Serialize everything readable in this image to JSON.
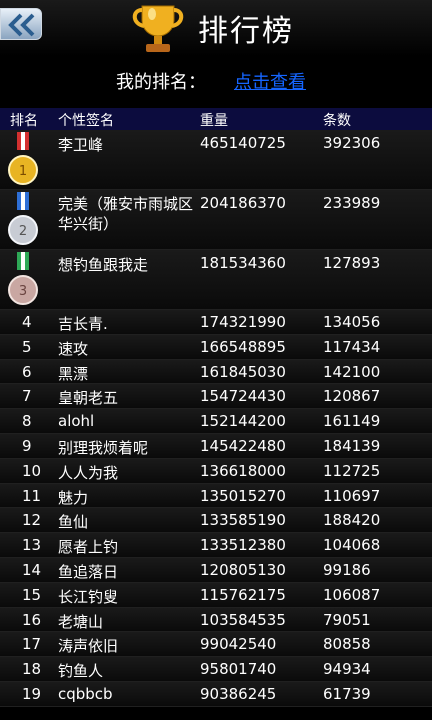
{
  "header": {
    "title": "排行榜"
  },
  "my_rank": {
    "label": "我的排名：",
    "link": "点击查看"
  },
  "table": {
    "columns": [
      "排名",
      "个性签名",
      "重量",
      "条数"
    ],
    "top_rows": [
      {
        "medal": "gold-medal-icon",
        "medal_number": "1",
        "ribbon_color": "#d33030",
        "medal_color": "#e8b423",
        "name": "李卫峰",
        "weight": "465140725",
        "count": "392306"
      },
      {
        "medal": "silver-medal-icon",
        "medal_number": "2",
        "ribbon_color": "#2e6fd6",
        "medal_color": "#c8ccd4",
        "name": "完美（雅安市雨城区华兴街）",
        "weight": "204186370",
        "count": "233989"
      },
      {
        "medal": "bronze-medal-icon",
        "medal_number": "3",
        "ribbon_color": "#2ea856",
        "medal_color": "#c9a7a2",
        "name": "想钓鱼跟我走",
        "weight": "181534360",
        "count": "127893"
      }
    ],
    "rows": [
      {
        "rank": "4",
        "name": "吉长青.",
        "weight": "174321990",
        "count": "134056"
      },
      {
        "rank": "5",
        "name": "速攻",
        "weight": "166548895",
        "count": "117434"
      },
      {
        "rank": "6",
        "name": "黑漂",
        "weight": "161845030",
        "count": "142100"
      },
      {
        "rank": "7",
        "name": "皇朝老五",
        "weight": "154724430",
        "count": "120867"
      },
      {
        "rank": "8",
        "name": "alohl",
        "weight": "152144200",
        "count": "161149"
      },
      {
        "rank": "9",
        "name": "别理我烦着呢",
        "weight": "145422480",
        "count": "184139"
      },
      {
        "rank": "10",
        "name": "人人为我",
        "weight": "136618000",
        "count": "112725"
      },
      {
        "rank": "11",
        "name": "魅力",
        "weight": "135015270",
        "count": "110697"
      },
      {
        "rank": "12",
        "name": "鱼仙",
        "weight": "133585190",
        "count": "188420"
      },
      {
        "rank": "13",
        "name": "愿者上钓",
        "weight": "133512380",
        "count": "104068"
      },
      {
        "rank": "14",
        "name": "鱼追落日",
        "weight": "120805130",
        "count": "99186"
      },
      {
        "rank": "15",
        "name": "长江钓叟",
        "weight": "115762175",
        "count": "106087"
      },
      {
        "rank": "16",
        "name": "老塘山",
        "weight": "103584535",
        "count": "79051"
      },
      {
        "rank": "17",
        "name": "涛声依旧",
        "weight": "99042540",
        "count": "80858"
      },
      {
        "rank": "18",
        "name": "钓鱼人",
        "weight": "95801740",
        "count": "94934"
      },
      {
        "rank": "19",
        "name": "cqbbcb",
        "weight": "90386245",
        "count": "61739"
      }
    ]
  }
}
